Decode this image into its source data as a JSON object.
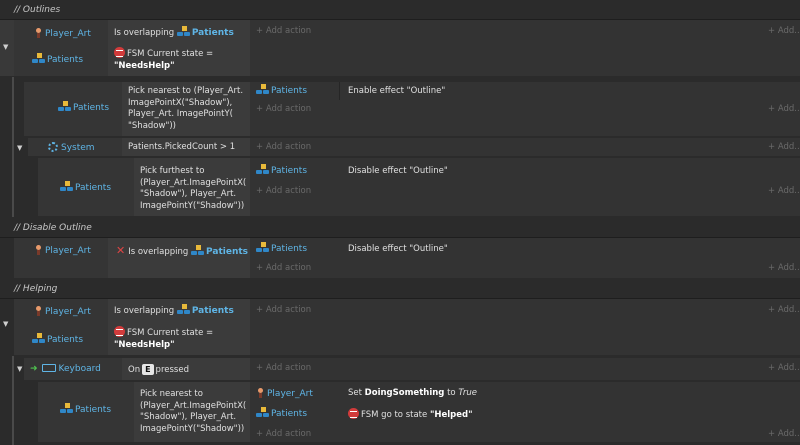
{
  "sections": {
    "outlines": "// Outlines",
    "disable_outline": "// Disable Outline",
    "helping": "// Helping"
  },
  "add_action": "+ Add action",
  "add_short": "+ Add...",
  "objects": {
    "player_art": "Player_Art",
    "patients": "Patients",
    "system": "System",
    "keyboard": "Keyboard"
  },
  "conditions": {
    "is_overlapping": "Is overlapping",
    "fsm_state_prefix": "FSM Current state =",
    "needs_help": "\"NeedsHelp\"",
    "pick_nearest": "Pick nearest to (Player_Art. ImagePointX(\"Shadow\"), Player_Art. ImagePointY( \"Shadow\"))",
    "picked_count": "Patients.PickedCount > 1",
    "pick_furthest": "Pick furthest to (Player_Art.ImagePointX( \"Shadow\"), Player_Art. ImagePointY(\"Shadow\"))",
    "pick_nearest_2": "Pick nearest to (Player_Art.ImagePointX( \"Shadow\"), Player_Art. ImagePointY(\"Shadow\"))",
    "on": "On",
    "key_e": "E",
    "pressed": "pressed"
  },
  "actions": {
    "enable_outline": "Enable effect \"Outline\"",
    "disable_outline": "Disable effect \"Outline\"",
    "set_prefix": "Set",
    "doing_something": "DoingSomething",
    "to": "to",
    "true_val": "True",
    "fsm_go_to": "FSM go to state",
    "helped": "\"Helped\""
  },
  "colors": {
    "object_blue": "#5fb5e6",
    "fsm_red": "#d23b3b",
    "trigger_green": "#4fc34f",
    "invert_red": "#e04545"
  }
}
